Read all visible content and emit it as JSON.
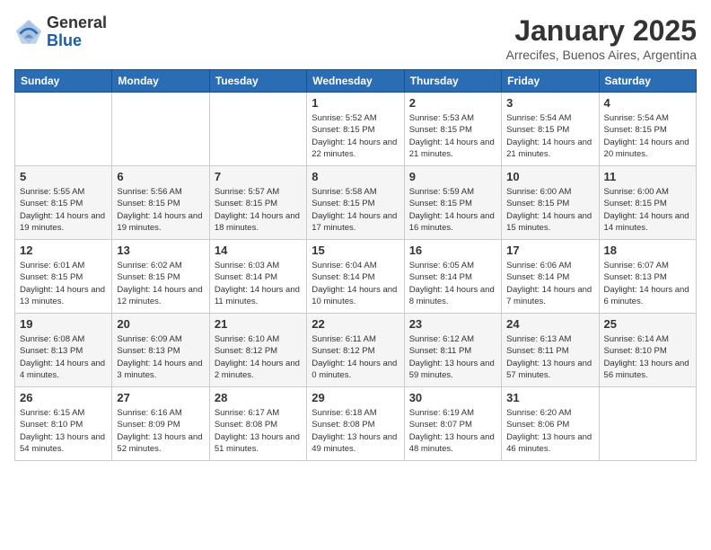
{
  "header": {
    "logo_line1": "General",
    "logo_line2": "Blue",
    "month": "January 2025",
    "location": "Arrecifes, Buenos Aires, Argentina"
  },
  "weekdays": [
    "Sunday",
    "Monday",
    "Tuesday",
    "Wednesday",
    "Thursday",
    "Friday",
    "Saturday"
  ],
  "weeks": [
    [
      {
        "day": "",
        "info": ""
      },
      {
        "day": "",
        "info": ""
      },
      {
        "day": "",
        "info": ""
      },
      {
        "day": "1",
        "info": "Sunrise: 5:52 AM\nSunset: 8:15 PM\nDaylight: 14 hours and 22 minutes."
      },
      {
        "day": "2",
        "info": "Sunrise: 5:53 AM\nSunset: 8:15 PM\nDaylight: 14 hours and 21 minutes."
      },
      {
        "day": "3",
        "info": "Sunrise: 5:54 AM\nSunset: 8:15 PM\nDaylight: 14 hours and 21 minutes."
      },
      {
        "day": "4",
        "info": "Sunrise: 5:54 AM\nSunset: 8:15 PM\nDaylight: 14 hours and 20 minutes."
      }
    ],
    [
      {
        "day": "5",
        "info": "Sunrise: 5:55 AM\nSunset: 8:15 PM\nDaylight: 14 hours and 19 minutes."
      },
      {
        "day": "6",
        "info": "Sunrise: 5:56 AM\nSunset: 8:15 PM\nDaylight: 14 hours and 19 minutes."
      },
      {
        "day": "7",
        "info": "Sunrise: 5:57 AM\nSunset: 8:15 PM\nDaylight: 14 hours and 18 minutes."
      },
      {
        "day": "8",
        "info": "Sunrise: 5:58 AM\nSunset: 8:15 PM\nDaylight: 14 hours and 17 minutes."
      },
      {
        "day": "9",
        "info": "Sunrise: 5:59 AM\nSunset: 8:15 PM\nDaylight: 14 hours and 16 minutes."
      },
      {
        "day": "10",
        "info": "Sunrise: 6:00 AM\nSunset: 8:15 PM\nDaylight: 14 hours and 15 minutes."
      },
      {
        "day": "11",
        "info": "Sunrise: 6:00 AM\nSunset: 8:15 PM\nDaylight: 14 hours and 14 minutes."
      }
    ],
    [
      {
        "day": "12",
        "info": "Sunrise: 6:01 AM\nSunset: 8:15 PM\nDaylight: 14 hours and 13 minutes."
      },
      {
        "day": "13",
        "info": "Sunrise: 6:02 AM\nSunset: 8:15 PM\nDaylight: 14 hours and 12 minutes."
      },
      {
        "day": "14",
        "info": "Sunrise: 6:03 AM\nSunset: 8:14 PM\nDaylight: 14 hours and 11 minutes."
      },
      {
        "day": "15",
        "info": "Sunrise: 6:04 AM\nSunset: 8:14 PM\nDaylight: 14 hours and 10 minutes."
      },
      {
        "day": "16",
        "info": "Sunrise: 6:05 AM\nSunset: 8:14 PM\nDaylight: 14 hours and 8 minutes."
      },
      {
        "day": "17",
        "info": "Sunrise: 6:06 AM\nSunset: 8:14 PM\nDaylight: 14 hours and 7 minutes."
      },
      {
        "day": "18",
        "info": "Sunrise: 6:07 AM\nSunset: 8:13 PM\nDaylight: 14 hours and 6 minutes."
      }
    ],
    [
      {
        "day": "19",
        "info": "Sunrise: 6:08 AM\nSunset: 8:13 PM\nDaylight: 14 hours and 4 minutes."
      },
      {
        "day": "20",
        "info": "Sunrise: 6:09 AM\nSunset: 8:13 PM\nDaylight: 14 hours and 3 minutes."
      },
      {
        "day": "21",
        "info": "Sunrise: 6:10 AM\nSunset: 8:12 PM\nDaylight: 14 hours and 2 minutes."
      },
      {
        "day": "22",
        "info": "Sunrise: 6:11 AM\nSunset: 8:12 PM\nDaylight: 14 hours and 0 minutes."
      },
      {
        "day": "23",
        "info": "Sunrise: 6:12 AM\nSunset: 8:11 PM\nDaylight: 13 hours and 59 minutes."
      },
      {
        "day": "24",
        "info": "Sunrise: 6:13 AM\nSunset: 8:11 PM\nDaylight: 13 hours and 57 minutes."
      },
      {
        "day": "25",
        "info": "Sunrise: 6:14 AM\nSunset: 8:10 PM\nDaylight: 13 hours and 56 minutes."
      }
    ],
    [
      {
        "day": "26",
        "info": "Sunrise: 6:15 AM\nSunset: 8:10 PM\nDaylight: 13 hours and 54 minutes."
      },
      {
        "day": "27",
        "info": "Sunrise: 6:16 AM\nSunset: 8:09 PM\nDaylight: 13 hours and 52 minutes."
      },
      {
        "day": "28",
        "info": "Sunrise: 6:17 AM\nSunset: 8:08 PM\nDaylight: 13 hours and 51 minutes."
      },
      {
        "day": "29",
        "info": "Sunrise: 6:18 AM\nSunset: 8:08 PM\nDaylight: 13 hours and 49 minutes."
      },
      {
        "day": "30",
        "info": "Sunrise: 6:19 AM\nSunset: 8:07 PM\nDaylight: 13 hours and 48 minutes."
      },
      {
        "day": "31",
        "info": "Sunrise: 6:20 AM\nSunset: 8:06 PM\nDaylight: 13 hours and 46 minutes."
      },
      {
        "day": "",
        "info": ""
      }
    ]
  ]
}
